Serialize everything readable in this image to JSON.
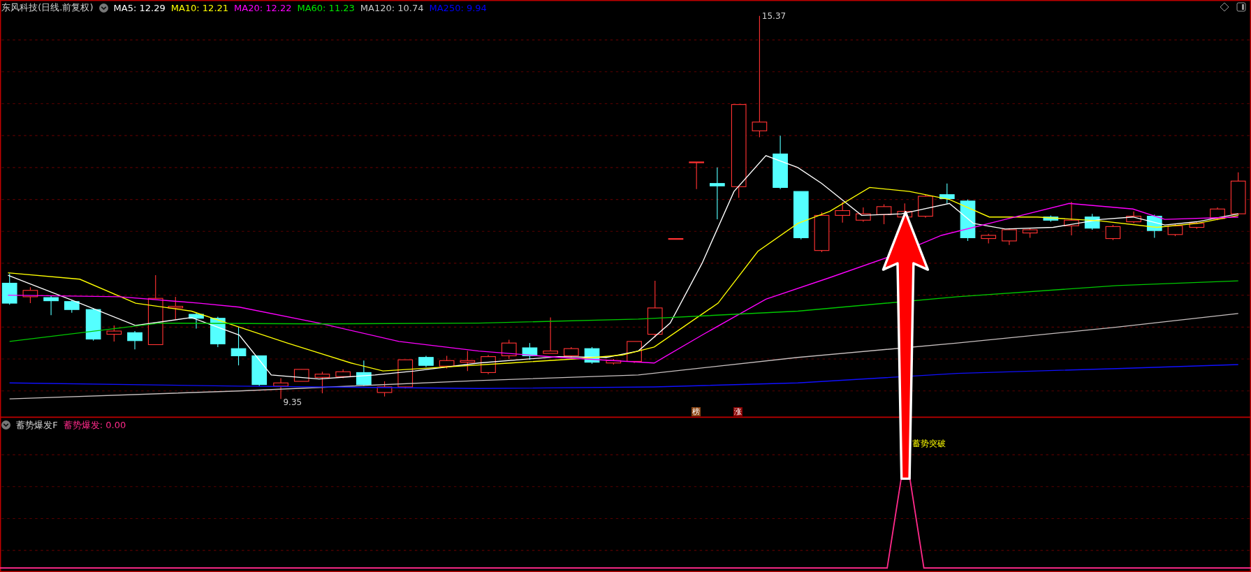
{
  "main_panel": {
    "title": "东风科技(日线.前复权)",
    "indicators": [
      {
        "label": "MA5: 12.29",
        "color": "#ffffff"
      },
      {
        "label": "MA10: 12.21",
        "color": "#ffff00"
      },
      {
        "label": "MA20: 12.22",
        "color": "#ff00ff"
      },
      {
        "label": "MA60: 11.23",
        "color": "#00e600"
      },
      {
        "label": "MA120: 10.74",
        "color": "#c8c8c8"
      },
      {
        "label": "MA250: 9.94",
        "color": "#0000ff"
      }
    ],
    "high_label": "15.37",
    "low_label": "9.35",
    "badges": [
      {
        "text": "榜",
        "color": "#8b4513"
      },
      {
        "text": "涨",
        "color": "#8b0000"
      }
    ]
  },
  "sub_panel": {
    "title": "蓄势爆发F",
    "value": "蓄势爆发: 0.00",
    "signal_label": "蓄势突破"
  }
}
